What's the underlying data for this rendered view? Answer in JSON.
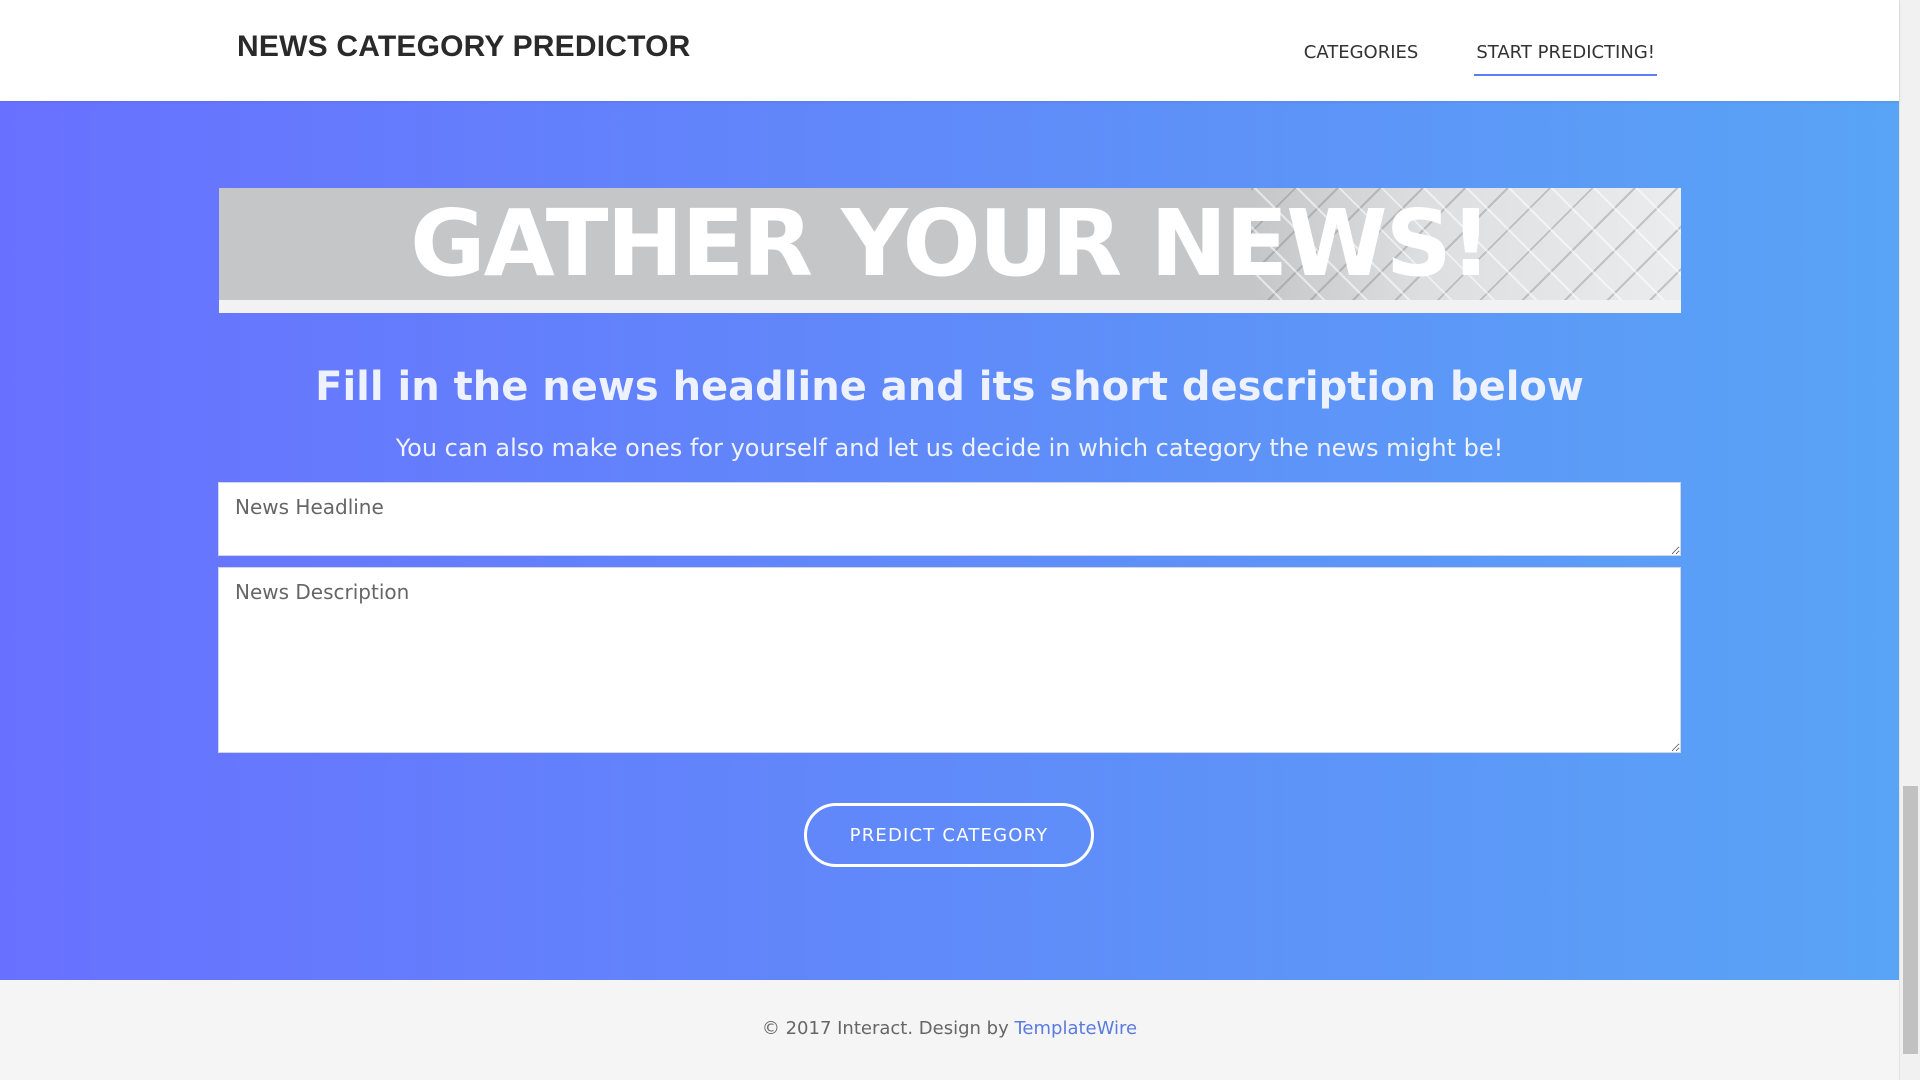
{
  "header": {
    "brand": "NEWS CATEGORY PREDICTOR",
    "nav": [
      {
        "label": "CATEGORIES",
        "active": false
      },
      {
        "label": "START PREDICTING!",
        "active": true
      }
    ]
  },
  "banner": {
    "title": "GATHER YOUR NEWS!"
  },
  "form": {
    "title": "Fill in the news headline and its short description below",
    "subtitle": "You can also make ones for yourself and let us decide in which category the news might be!",
    "headline_placeholder": "News Headline",
    "description_placeholder": "News Description",
    "submit_label": "PREDICT CATEGORY"
  },
  "footer": {
    "text": "© 2017 Interact. Design by ",
    "link_text": "TemplateWire"
  },
  "colors": {
    "gradient_start": "#6871ff",
    "gradient_end": "#59a4f6",
    "nav_underline": "#5c7cfa",
    "footer_link": "#5a7be0"
  }
}
